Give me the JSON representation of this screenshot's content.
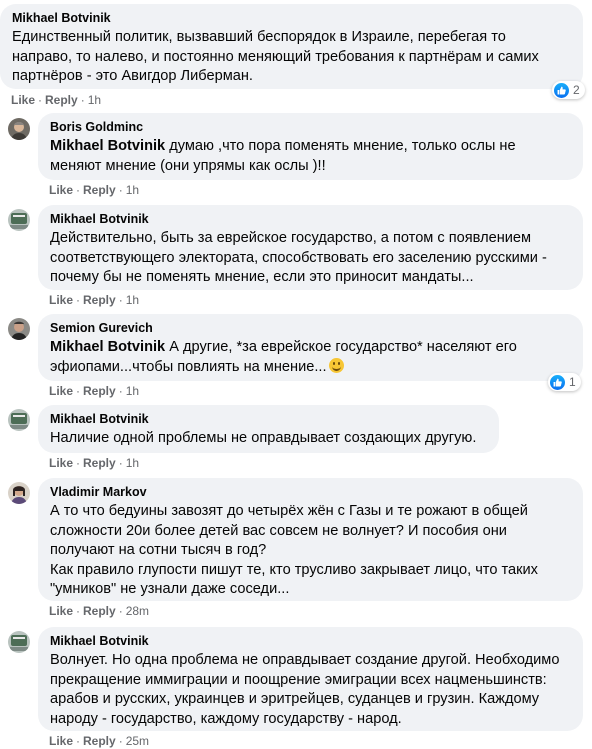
{
  "comments": [
    {
      "author": "Mikhael Botvinik",
      "text": "Единственный политик, вызвавший беспорядок в Израиле, перебегая то\nнаправо, то налево, и постоянно меняющий требования к партнёрам и самих\nпартнёров - это Авигдор Либерман.",
      "like": "Like",
      "reply": "Reply",
      "time": "1h",
      "reactions": "2"
    },
    {
      "author": "Boris Goldminc",
      "mention": "Mikhael Botvinik",
      "text": " думаю ,что пора поменять мнение, только ослы не\nменяют мнение (они упрямы как ослы )!!",
      "like": "Like",
      "reply": "Reply",
      "time": "1h"
    },
    {
      "author": "Mikhael Botvinik",
      "text": "Действительно, быть за еврейское государство, а потом с появлением\nсоответствующего электората, способствовать его заселению русскими -\nпочему бы не поменять мнение, если это приносит мандаты...",
      "like": "Like",
      "reply": "Reply",
      "time": "1h"
    },
    {
      "author": "Semion Gurevich",
      "mention": "Mikhael Botvinik",
      "text": " А другие, *за еврейское государство* населяют его\nэфиопами...чтобы повлиять на мнение...",
      "like": "Like",
      "reply": "Reply",
      "time": "1h",
      "reactions": "1"
    },
    {
      "author": "Mikhael Botvinik",
      "text": "Наличие одной проблемы не оправдывает создающих другую.",
      "like": "Like",
      "reply": "Reply",
      "time": "1h"
    },
    {
      "author": "Vladimir Markov",
      "text": "А то что бедуины завозят до четырёх жён с Газы и те рожают в общей\nсложности 20и более детей вас совсем не волнует? И пособия они\nполучают на сотни тысяч в год?\nКак правило глупости пишут те, кто трусливо закрывает лицо, что таких\n\"умников\" не узнали даже соседи...",
      "like": "Like",
      "reply": "Reply",
      "time": "28m"
    },
    {
      "author": "Mikhael Botvinik",
      "text": "Волнует. Но одна проблема не оправдывает создание другой. Необходимо\nпрекращение иммиграции и поощрение эмиграции всех нацменьшинств:\nарабов и русских, украинцев и эритрейцев, суданцев и грузин. Каждому\nнароду - государство, каждому государству - народ.",
      "like": "Like",
      "reply": "Reply",
      "time": "25m"
    }
  ]
}
